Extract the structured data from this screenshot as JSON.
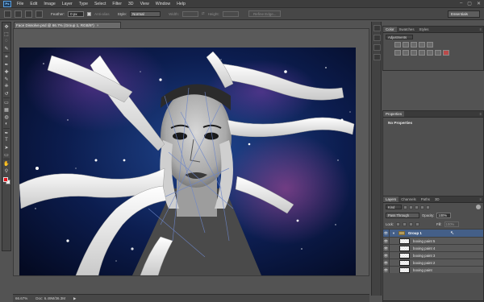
{
  "app": {
    "logo": "Ps"
  },
  "menubar": {
    "items": [
      "File",
      "Edit",
      "Image",
      "Layer",
      "Type",
      "Select",
      "Filter",
      "3D",
      "View",
      "Window",
      "Help"
    ],
    "window_controls": [
      "–",
      "▢",
      "✕"
    ]
  },
  "options": {
    "feather_label": "Feather:",
    "feather_value": "0 px",
    "antialias_label": "Anti-alias",
    "style_label": "Style:",
    "style_value": "Normal",
    "width_label": "Width:",
    "height_label": "Height:",
    "refine_button": "Refine Edge...",
    "workspace": "Essentials"
  },
  "document": {
    "tab_title": "Face Dissolve.psd @ 66.7% (Group 1, RGB/8*)",
    "close_symbol": "×",
    "zoom": "66.67%",
    "doc_size": "Doc: 6.49M/36.3M"
  },
  "colors": {
    "foreground": "#e8141b",
    "background": "#f0f0f0"
  },
  "tools": [
    "move-icon",
    "marquee-icon",
    "lasso-icon",
    "quick-select-icon",
    "crop-icon",
    "eyedropper-icon",
    "healing-icon",
    "brush-icon",
    "clone-stamp-icon",
    "history-brush-icon",
    "eraser-icon",
    "gradient-icon",
    "blur-icon",
    "dodge-icon",
    "pen-icon",
    "type-icon",
    "path-select-icon",
    "shape-icon",
    "hand-icon",
    "zoom-icon"
  ],
  "tool_glyphs": [
    "✥",
    "⬚",
    "◌",
    "✎",
    "⌗",
    "✒",
    "✚",
    "✎",
    "⎈",
    "↺",
    "▭",
    "▦",
    "◍",
    "◐",
    "✒",
    "T",
    "➤",
    "▭",
    "✋",
    "⚲"
  ],
  "adjustments": {
    "tabs": [
      "Color",
      "Swatches",
      "Styles"
    ],
    "active_tab": "Adjustments",
    "dropdown": "Adjustments"
  },
  "properties": {
    "tab": "Properties",
    "empty_text": "No Properties"
  },
  "layers": {
    "tabs": [
      "Layers",
      "Channels",
      "Paths",
      "3D"
    ],
    "kind": "Kind",
    "blend_mode": "Pass Through",
    "opacity_label": "Opacity:",
    "opacity_value": "100%",
    "lock_label": "Lock:",
    "fill_label": "Fill:",
    "fill_value": "100%",
    "group_name": "Group 1",
    "items": [
      "boxing paint 5",
      "boxing paint 4",
      "boxing paint 3",
      "boxing paint 2",
      "boxing paint"
    ]
  }
}
